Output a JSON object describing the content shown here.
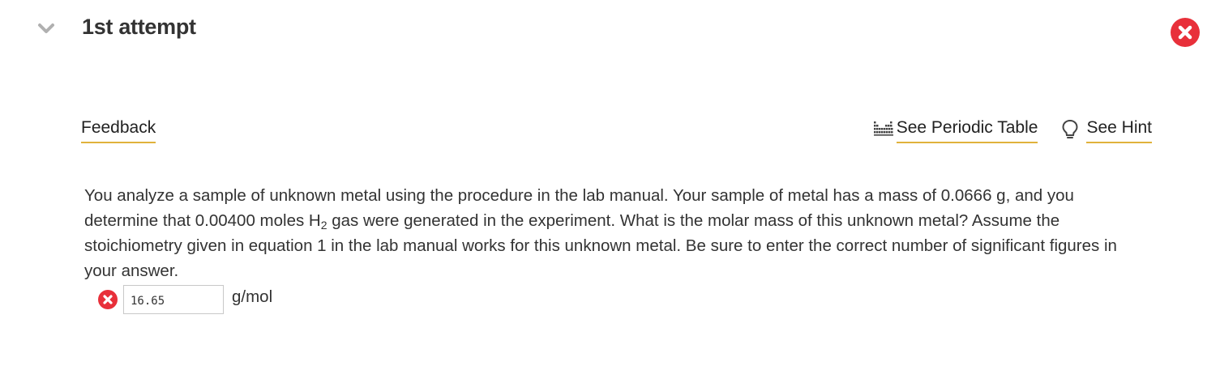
{
  "attempt": {
    "title": "1st attempt",
    "status": "incorrect"
  },
  "links": {
    "feedback": "Feedback",
    "periodic_table": "See Periodic Table",
    "hint": "See Hint"
  },
  "icons": {
    "collapse": "chevron-down-icon",
    "status": "error-x-icon",
    "periodic_table": "periodic-table-icon",
    "hint": "lightbulb-icon"
  },
  "question": {
    "part1": "You analyze a sample of unknown metal using the procedure in the lab manual.  Your sample of metal has a mass of 0.0666 g, and you determine that 0.00400 moles H",
    "subscript": "2",
    "part2": " gas were generated in the experiment.  What is the molar mass of this unknown metal?  Assume the stoichiometry given in equation 1 in the lab manual works for this unknown metal.  Be sure to enter the correct number of significant figures in your answer."
  },
  "answer": {
    "value": "16.65",
    "unit": "g/mol",
    "status": "incorrect"
  },
  "colors": {
    "error_red": "#e8303a",
    "underline_gold": "#e0b23c",
    "text": "#333333",
    "chevron_gray": "#b0b0b0"
  }
}
